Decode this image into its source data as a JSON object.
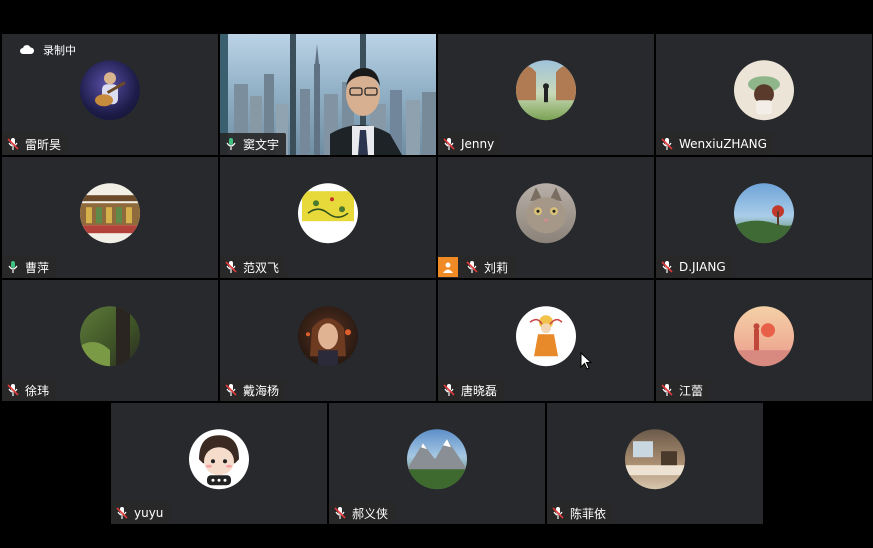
{
  "recording": {
    "label": "录制中"
  },
  "colors": {
    "tile_bg": "#27292d",
    "active_border": "#3fc17f",
    "mic_muted": "#e33b3b",
    "host_badge": "#f08a24"
  },
  "participants": [
    {
      "name": "雷昕昊",
      "mic": "muted",
      "avatar": "guitar"
    },
    {
      "name": "窦文宇",
      "mic": "on",
      "video": true
    },
    {
      "name": "Jenny",
      "mic": "muted",
      "avatar": "courtyard"
    },
    {
      "name": "WenxiuZHANG",
      "mic": "muted",
      "avatar": "girl-hat"
    },
    {
      "name": "曹萍",
      "mic": "on",
      "avatar": "library"
    },
    {
      "name": "范双飞",
      "mic": "muted",
      "avatar": "yellow-art"
    },
    {
      "name": "刘莉",
      "mic": "muted",
      "avatar": "cat",
      "host": true
    },
    {
      "name": "D.JIANG",
      "mic": "muted",
      "avatar": "sky"
    },
    {
      "name": "徐玮",
      "mic": "muted",
      "avatar": "forest"
    },
    {
      "name": "戴海杨",
      "mic": "muted",
      "avatar": "portrait"
    },
    {
      "name": "唐晓磊",
      "mic": "muted",
      "avatar": "cartoon"
    },
    {
      "name": "江蕾",
      "mic": "muted",
      "avatar": "sunset"
    },
    {
      "name": "yuyu",
      "mic": "muted",
      "avatar": "chibi"
    },
    {
      "name": "郝义侠",
      "mic": "muted",
      "avatar": "mountain"
    },
    {
      "name": "陈菲依",
      "mic": "muted",
      "avatar": "room"
    }
  ]
}
